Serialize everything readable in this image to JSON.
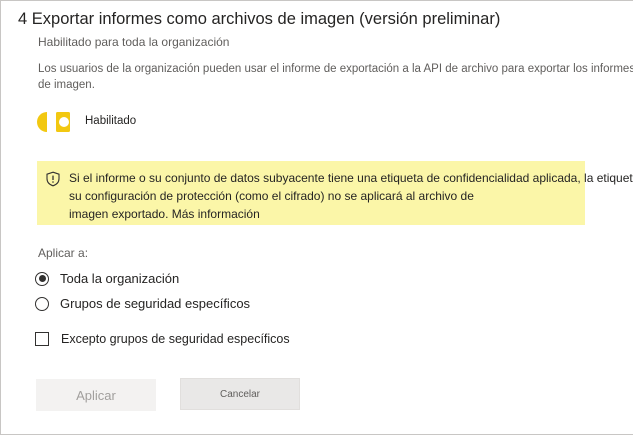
{
  "setting": {
    "title": "4 Exportar informes como archivos de imagen (versión preliminar)",
    "scope": "Habilitado para toda la organización",
    "description_line1": "Los usuarios de la organización pueden usar el informe de exportación a la API de archivo para exportar los informes como archivos",
    "description_line2": "de imagen."
  },
  "toggle": {
    "state": "on",
    "label": "Habilitado",
    "accent_color": "#f2c811"
  },
  "warning": {
    "line1": "Si el informe o su conjunto de datos subyacente tiene una etiqueta de confidencialidad aplicada, la etiqueta y",
    "line2": "su configuración de protección (como el cifrado) no se aplicará al archivo de",
    "line3": "imagen exportado.",
    "link": "Más información",
    "background": "#fbf6a8"
  },
  "apply_to": {
    "label": "Aplicar a:",
    "options": [
      {
        "label": "Toda la organización",
        "selected": true
      },
      {
        "label": "Grupos de seguridad específicos",
        "selected": false
      }
    ],
    "except_label": "Excepto grupos de seguridad específicos",
    "except_checked": false
  },
  "buttons": {
    "apply": "Aplicar",
    "cancel": "Cancelar"
  }
}
